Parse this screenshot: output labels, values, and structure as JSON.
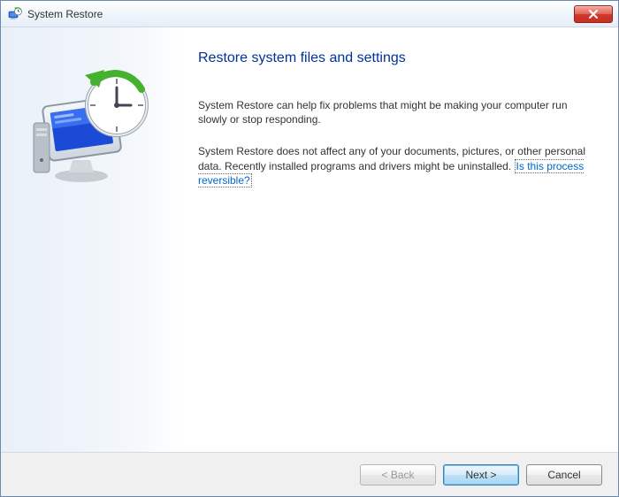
{
  "titlebar": {
    "title": "System Restore"
  },
  "content": {
    "heading": "Restore system files and settings",
    "para1": "System Restore can help fix problems that might be making your computer run slowly or stop responding.",
    "para2_pre": "System Restore does not affect any of your documents, pictures, or other personal data. Recently installed programs and drivers might be uninstalled. ",
    "para2_link": "Is this process reversible?"
  },
  "footer": {
    "back": "< Back",
    "next": "Next >",
    "cancel": "Cancel"
  }
}
